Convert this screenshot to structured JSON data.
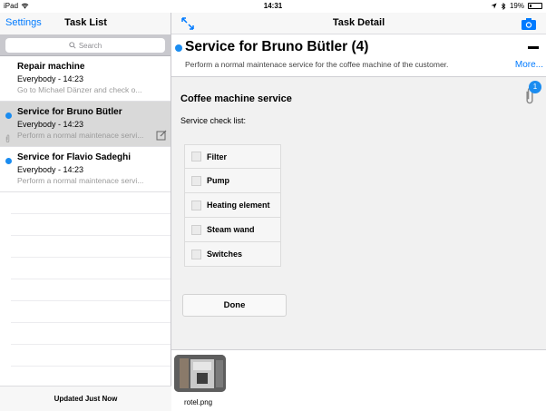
{
  "status_bar": {
    "carrier": "iPad",
    "time": "14:31",
    "battery": "19%",
    "battery_fill": 0.19
  },
  "left_nav": {
    "settings_label": "Settings",
    "title": "Task List"
  },
  "search": {
    "placeholder": "Search"
  },
  "tasks": [
    {
      "title": "Repair machine",
      "subtitle": "Everybody - 14:23",
      "description": "Go to Michael Dänzer and check o...",
      "unread": false,
      "selected": false
    },
    {
      "title": "Service for Bruno Bütler",
      "subtitle": "Everybody - 14:23",
      "description": "Perform a normal maintenace servi...",
      "unread": true,
      "selected": true
    },
    {
      "title": "Service for Flavio Sadeghi",
      "subtitle": "Everybody - 14:23",
      "description": "Perform a normal maintenace servi...",
      "unread": true,
      "selected": false
    }
  ],
  "left_footer": {
    "status": "Updated Just Now"
  },
  "right_nav": {
    "title": "Task Detail"
  },
  "detail": {
    "title": "Service for Bruno Bütler (4)",
    "description": "Perform a normal maintenace service for the coffee machine of the customer.",
    "more_label": "More...",
    "attachment_count": "1"
  },
  "form": {
    "section_title": "Coffee machine service",
    "checklist_label": "Service check list:",
    "items": [
      "Filter",
      "Pump",
      "Heating element",
      "Steam wand",
      "Switches"
    ],
    "done_label": "Done"
  },
  "attachments": [
    {
      "caption": "rotel.png"
    }
  ],
  "colors": {
    "accent": "#007aff",
    "unread_dot": "#1a8cf0",
    "selected_row": "#d9d9d9"
  }
}
